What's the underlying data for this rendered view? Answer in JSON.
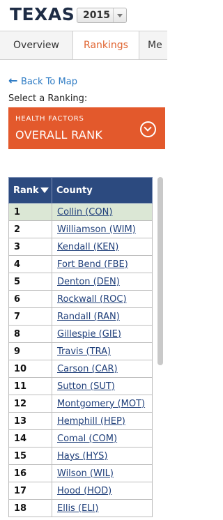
{
  "header": {
    "state": "TEXAS",
    "year": "2015"
  },
  "tabs": [
    {
      "label": "Overview"
    },
    {
      "label": "Rankings"
    },
    {
      "label": "Me"
    }
  ],
  "nav": {
    "back_label": "Back To Map",
    "back_icon": "left-arrow-icon"
  },
  "ranking": {
    "select_label": "Select a Ranking:",
    "category": "HEALTH FACTORS",
    "title": "OVERALL RANK",
    "accent_color": "#e3592c"
  },
  "table": {
    "headers": {
      "rank": "Rank",
      "county": "County"
    },
    "rows": [
      {
        "rank": "1",
        "county": "Collin (CON)"
      },
      {
        "rank": "2",
        "county": "Williamson (WIM)"
      },
      {
        "rank": "3",
        "county": "Kendall (KEN)"
      },
      {
        "rank": "4",
        "county": "Fort Bend (FBE)"
      },
      {
        "rank": "5",
        "county": "Denton (DEN)"
      },
      {
        "rank": "6",
        "county": "Rockwall (ROC)"
      },
      {
        "rank": "7",
        "county": "Randall (RAN)"
      },
      {
        "rank": "8",
        "county": "Gillespie (GIE)"
      },
      {
        "rank": "9",
        "county": "Travis (TRA)"
      },
      {
        "rank": "10",
        "county": "Carson (CAR)"
      },
      {
        "rank": "11",
        "county": "Sutton (SUT)"
      },
      {
        "rank": "12",
        "county": "Montgomery (MOT)"
      },
      {
        "rank": "13",
        "county": "Hemphill (HEP)"
      },
      {
        "rank": "14",
        "county": "Comal (COM)"
      },
      {
        "rank": "15",
        "county": "Hays (HYS)"
      },
      {
        "rank": "16",
        "county": "Wilson (WIL)"
      },
      {
        "rank": "17",
        "county": "Hood (HOD)"
      },
      {
        "rank": "18",
        "county": "Ellis (ELI)"
      }
    ]
  }
}
